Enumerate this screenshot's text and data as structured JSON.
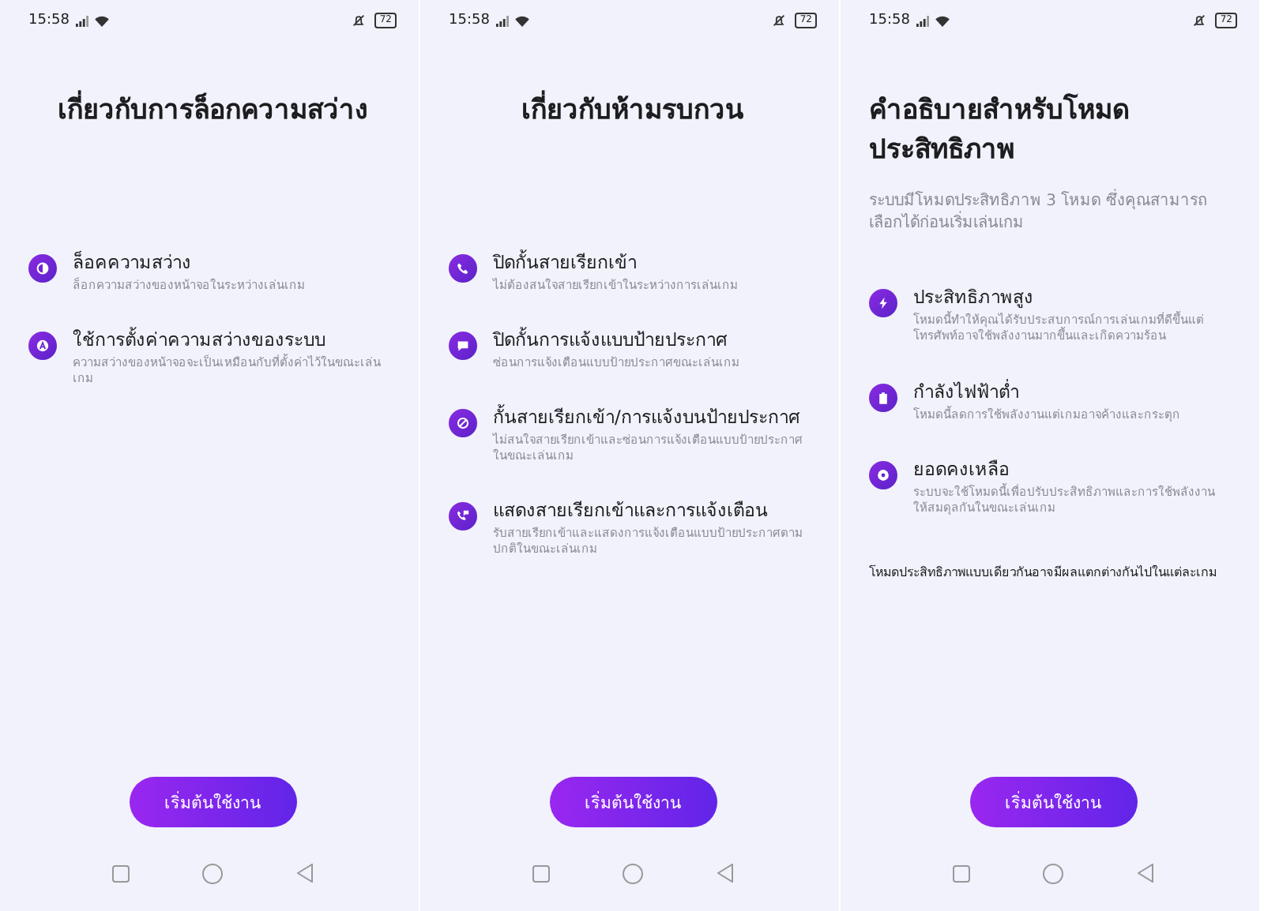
{
  "screens": [
    {
      "status": {
        "time": "15:58",
        "battery": "72"
      },
      "title": "เกี่ยวกับการล็อกความสว่าง",
      "items": [
        {
          "kind": "contrast",
          "title": "ล็อคความสว่าง",
          "description": "ล็อกความสว่างของหน้าจอในระหว่างเล่นเกม"
        },
        {
          "kind": "auto",
          "title": "ใช้การตั้งค่าความสว่างของระบบ",
          "description": "ความสว่างของหน้าจอจะเป็นเหมือนกับที่ตั้งค่าไว้ในขณะเล่นเกม"
        }
      ],
      "button": "เริ่มต้นใช้งาน"
    },
    {
      "status": {
        "time": "15:58",
        "battery": "72"
      },
      "title": "เกี่ยวกับห้ามรบกวน",
      "items": [
        {
          "kind": "phone",
          "title": "ปิดกั้นสายเรียกเข้า",
          "description": "ไม่ต้องสนใจสายเรียกเข้าในระหว่างการเล่นเกม"
        },
        {
          "kind": "banner",
          "title": "ปิดกั้นการแจ้งแบบป้ายประกาศ",
          "description": "ซ่อนการแจ้งเตือนแบบป้ายประกาศขณะเล่นเกม"
        },
        {
          "kind": "block",
          "title": "กั้นสายเรียกเข้า/การแจ้งบนป้ายประกาศ",
          "description": "ไม่สนใจสายเรียกเข้าและซ่อนการแจ้งเตือนแบบป้ายประกาศในขณะเล่นเกม"
        },
        {
          "kind": "callnotify",
          "title": "แสดงสายเรียกเข้าและการแจ้งเตือน",
          "description": "รับสายเรียกเข้าและแสดงการแจ้งเตือนแบบป้ายประกาศตามปกติในขณะเล่นเกม"
        }
      ],
      "button": "เริ่มต้นใช้งาน"
    },
    {
      "status": {
        "time": "15:58",
        "battery": "72"
      },
      "title": "คำอธิบายสำหรับโหมดประสิทธิภาพ",
      "intro": "ระบบมีโหมดประสิทธิภาพ 3 โหมด ซึ่งคุณสามารถเลือกได้ก่อนเริ่มเล่นเกม",
      "items": [
        {
          "kind": "bolt",
          "title": "ประสิทธิภาพสูง",
          "description": "โหมดนี้ทำให้คุณได้รับประสบการณ์การเล่นเกมที่ดีขึ้นแต่โทรศัพท์อาจใช้พลังงานมากขึ้นและเกิดความร้อน"
        },
        {
          "kind": "battery",
          "title": "กำลังไฟฟ้าต่ำ",
          "description": "โหมดนี้ลดการใช้พลังงานแต่เกมอาจค้างและกระตุก"
        },
        {
          "kind": "dot",
          "title": "ยอดคงเหลือ",
          "description": "ระบบจะใช้โหมดนี้เพื่อปรับประสิทธิภาพและการใช้พลังงานให้สมดุลกันในขณะเล่นเกม"
        }
      ],
      "note": "โหมดประสิทธิภาพแบบเดียวกันอาจมีผลแตกต่างกันไปในแต่ละเกม",
      "button": "เริ่มต้นใช้งาน"
    }
  ]
}
